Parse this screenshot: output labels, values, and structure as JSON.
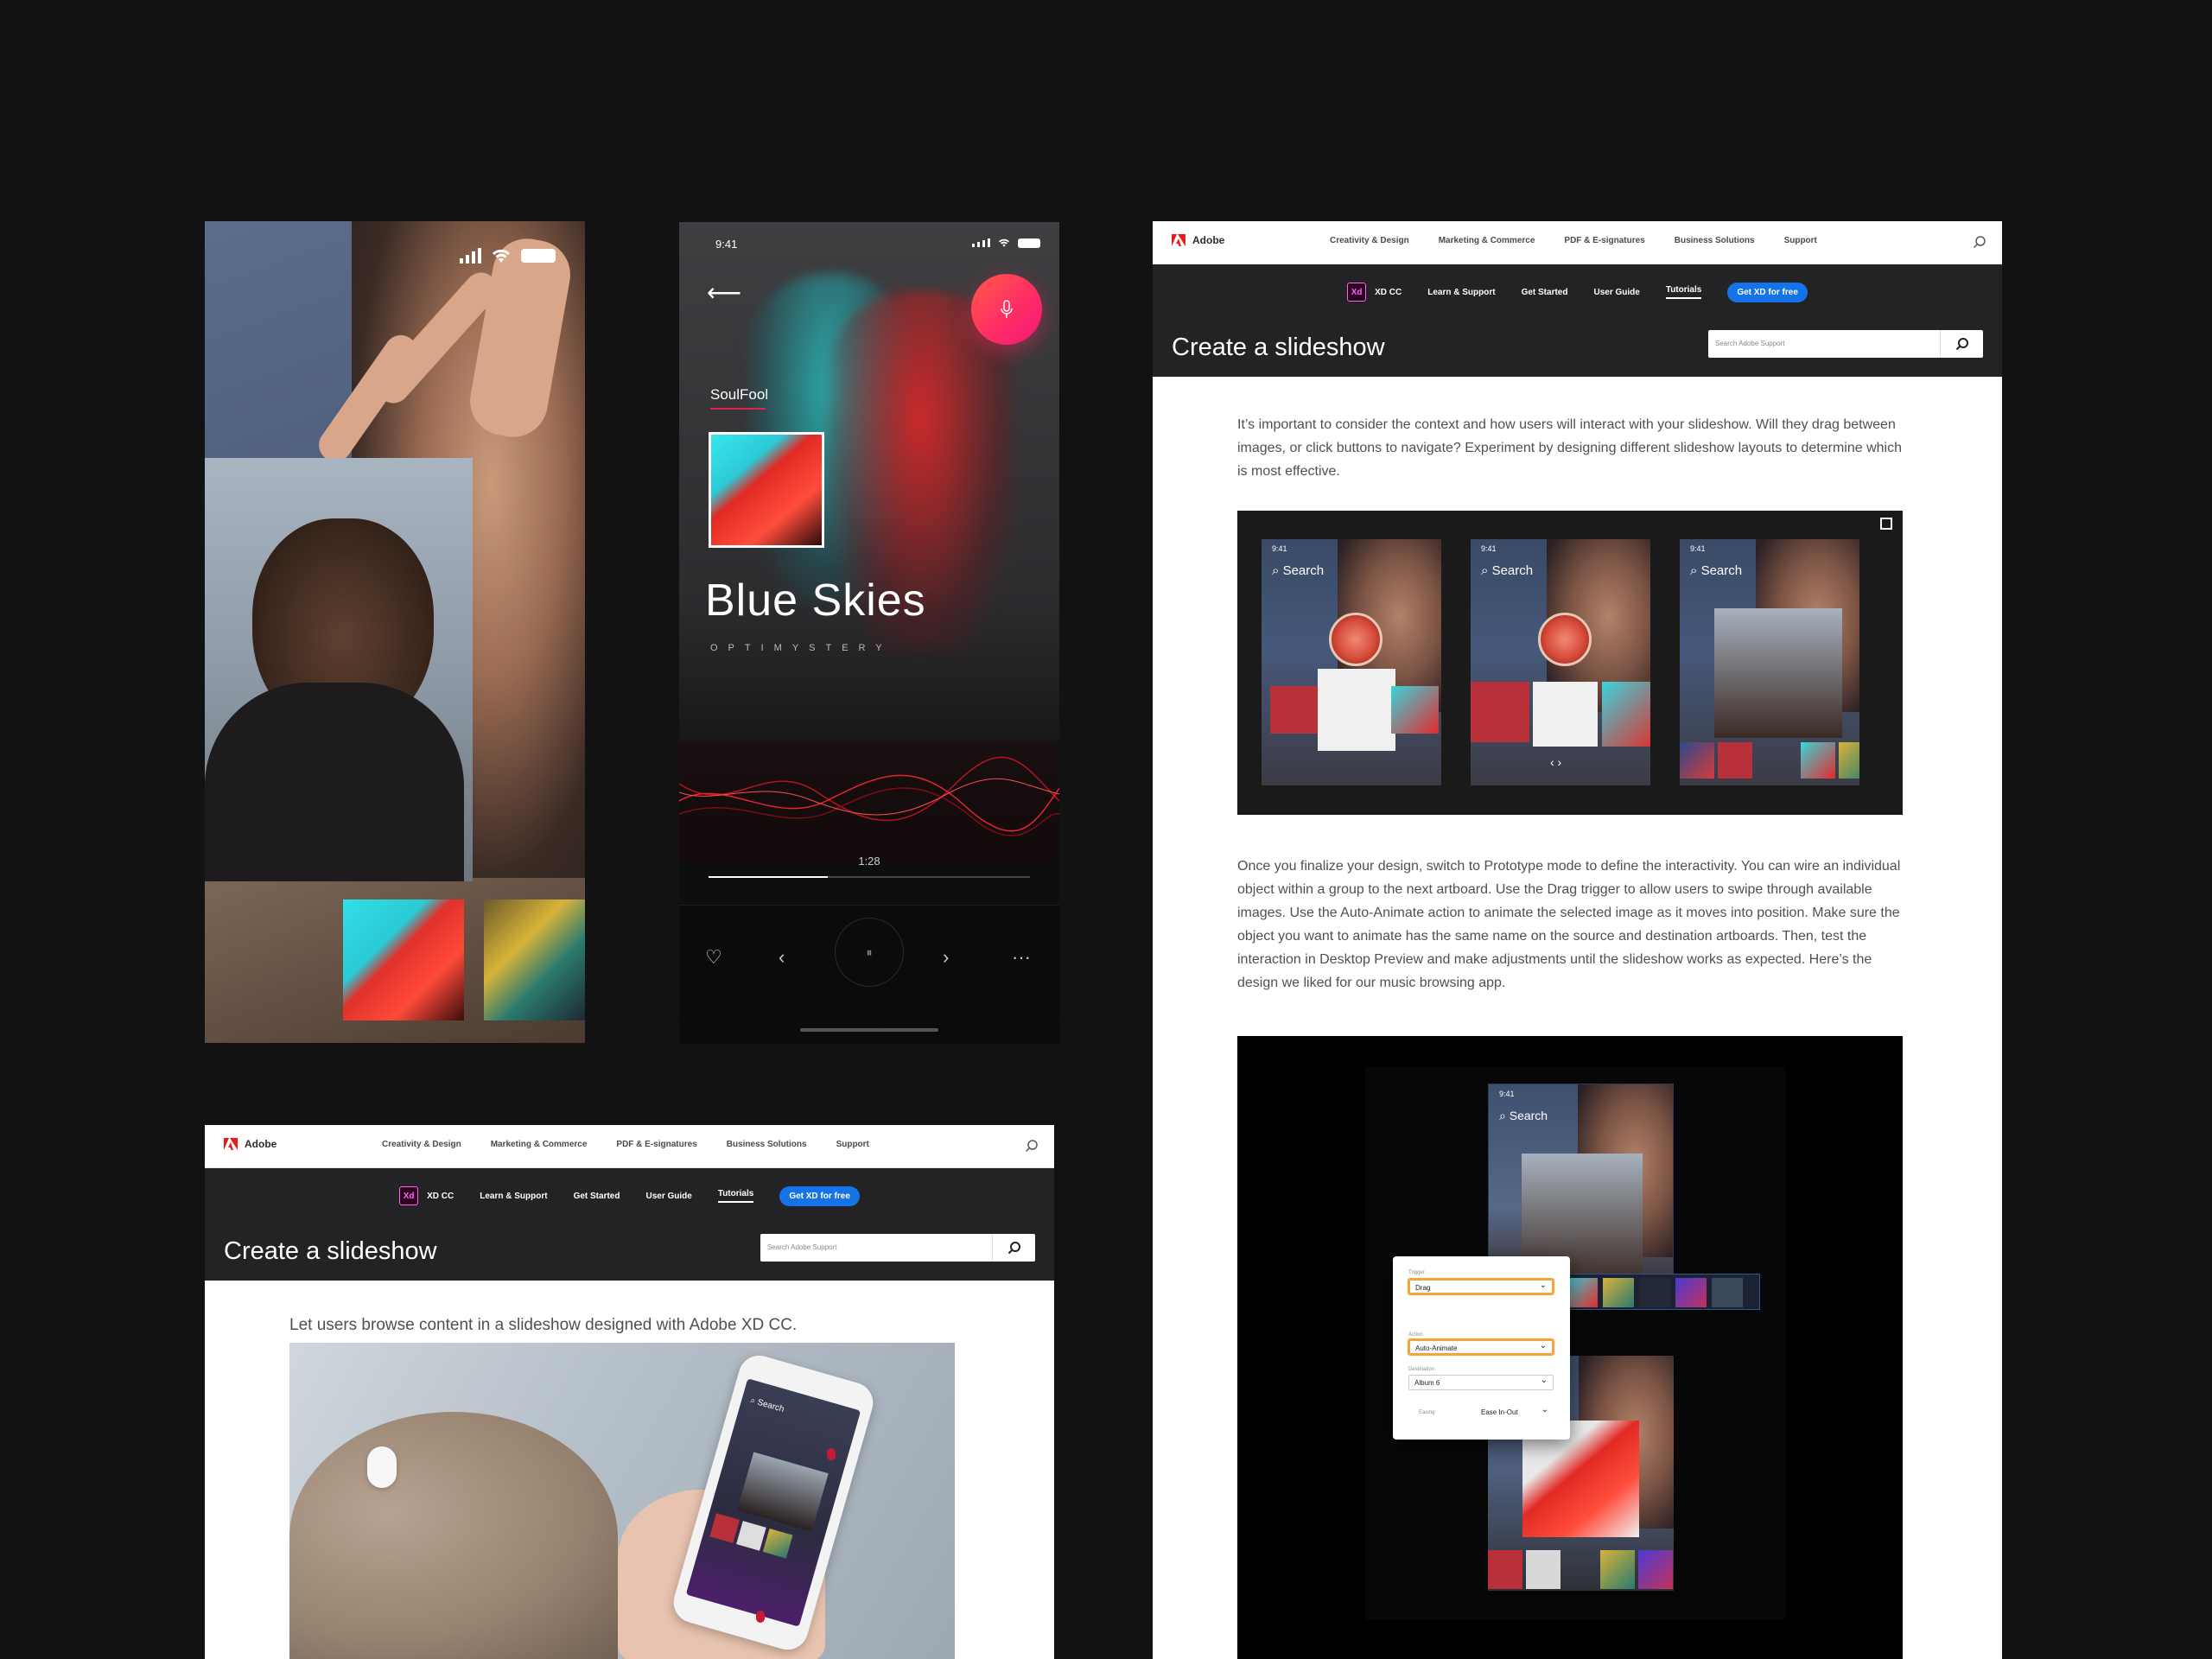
{
  "collage_phone": {
    "icons": [
      "signal-icon",
      "wifi-icon",
      "battery-icon"
    ]
  },
  "music_player": {
    "status_time": "9:41",
    "artist": "SoulFool",
    "song_title": "Blue Skies",
    "album": "OPTIMYSTERY",
    "playback_time": "1:28",
    "progress": 0.37,
    "colors": {
      "accent": "#e0234a",
      "mic_gradient_start": "#ff5a4a",
      "mic_gradient_end": "#f0197a"
    }
  },
  "adobe_nav": {
    "brand": "Adobe",
    "items": [
      "Creativity & Design",
      "Marketing & Commerce",
      "PDF & E-signatures",
      "Business Solutions",
      "Support"
    ],
    "product_badge": "Xd",
    "product_name": "XD CC",
    "sub_items": [
      "Learn & Support",
      "Get Started",
      "User Guide",
      "Tutorials"
    ],
    "active_sub_item": "Tutorials",
    "cta": "Get XD for free",
    "page_title": "Create a slideshow",
    "search_placeholder": "Search Adobe Support",
    "colors": {
      "cta": "#1473e6",
      "dark_band": "#232325"
    }
  },
  "tutorial_page": {
    "para1": "It’s important to consider the context and how users will interact with your slideshow. Will they drag between images, or click buttons to navigate? Experiment by designing different slideshow layouts to determine which is most effective.",
    "para2": "Once you finalize your design, switch to Prototype mode to define the interactivity. You can wire an individual object within a group to the next artboard. Use the Drag trigger to allow users to swipe through available images. Use the Auto-Animate action to animate the selected image as it moves into position. Make sure the object you want to animate has the same name on the source and destination artboards. Then, test the interaction in Desktop Preview and make adjustments until the slideshow works as expected. Here’s the design we liked for our music browsing app.",
    "mockups": [
      {
        "time": "9:41",
        "search": "Search"
      },
      {
        "time": "9:41",
        "search": "Search"
      },
      {
        "time": "9:41",
        "search": "Search"
      }
    ],
    "prototype": {
      "time": "9:41",
      "search": "Search",
      "trigger_label": "Trigger",
      "trigger_value": "Drag",
      "action_label": "Action",
      "action_value": "Auto-Animate",
      "destination_label": "Destination",
      "destination_value": "Album 6",
      "easing_label": "Easing",
      "easing_value": "Ease In-Out"
    }
  },
  "intro_page": {
    "intro": "Let users browse content in a slideshow designed with Adobe XD CC.",
    "phone_search": "Search"
  }
}
